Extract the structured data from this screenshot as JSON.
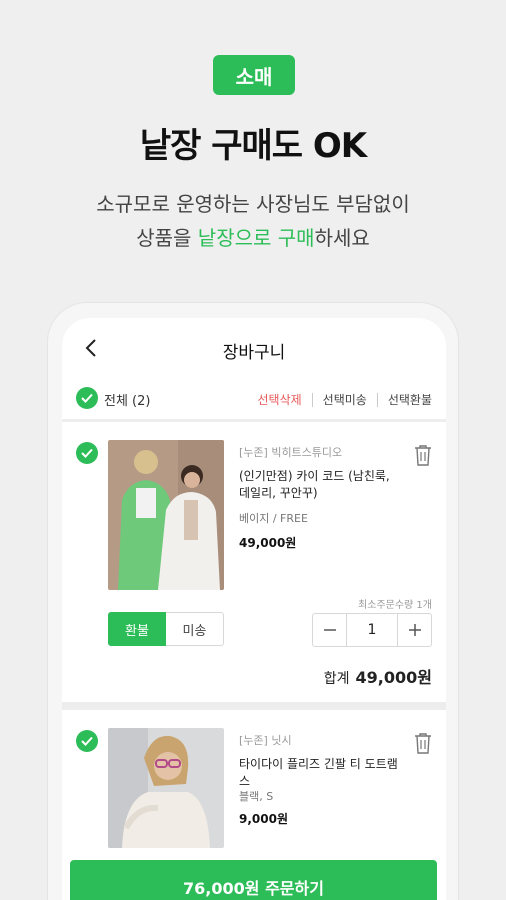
{
  "hero": {
    "badge": "소매",
    "headline": "낱장 구매도 OK",
    "sub1": "소규모로 운영하는 사장님도 부담없이",
    "sub2_pre": "상품을 ",
    "sub2_hl": "낱장으로 구매",
    "sub2_post": "하세요"
  },
  "header": {
    "title": "장바구니"
  },
  "selection": {
    "all_label": "전체 (2)",
    "actions": [
      "선택삭제",
      "선택미송",
      "선택환불"
    ]
  },
  "items": [
    {
      "shop": "[누존] 빅히트스튜디오",
      "name": "(인기만점) 카이 코드 (남친룩, 데일리, 꾸안꾸)",
      "option": "베이지 / FREE",
      "price": "49,000원",
      "toggle": [
        "환불",
        "미송"
      ],
      "min_qty": "최소주문수량 1개",
      "qty": "1",
      "total_label": "합계",
      "total_value": "49,000원"
    },
    {
      "shop": "[누존] 닛시",
      "name": "타이다이 플리즈 긴팔 티 도트램스",
      "option": "블랙, S",
      "price": "9,000원"
    }
  ],
  "order_button": "76,000원 주문하기",
  "colors": {
    "accent": "#2dbd58",
    "danger": "#e85a5a"
  }
}
